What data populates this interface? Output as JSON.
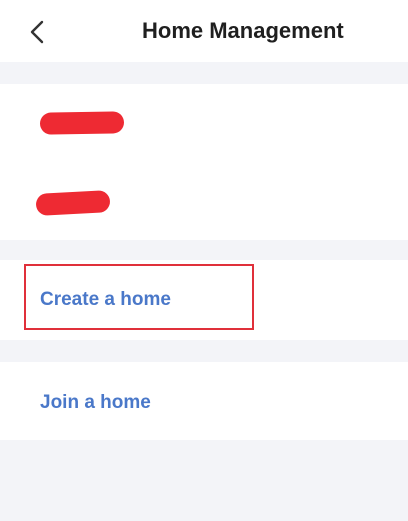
{
  "header": {
    "title": "Home Management",
    "back_icon": "chevron-left-icon"
  },
  "homes": [
    {
      "label": "",
      "redacted": true
    },
    {
      "label": "",
      "redacted": true
    }
  ],
  "actions": {
    "create_label": "Create a home",
    "join_label": "Join a home"
  },
  "colors": {
    "background": "#ffffff",
    "separator": "#f3f4f8",
    "title": "#1f1f1f",
    "link": "#4a78c9",
    "highlight": "#e0303a",
    "redaction": "#ee2a33"
  }
}
